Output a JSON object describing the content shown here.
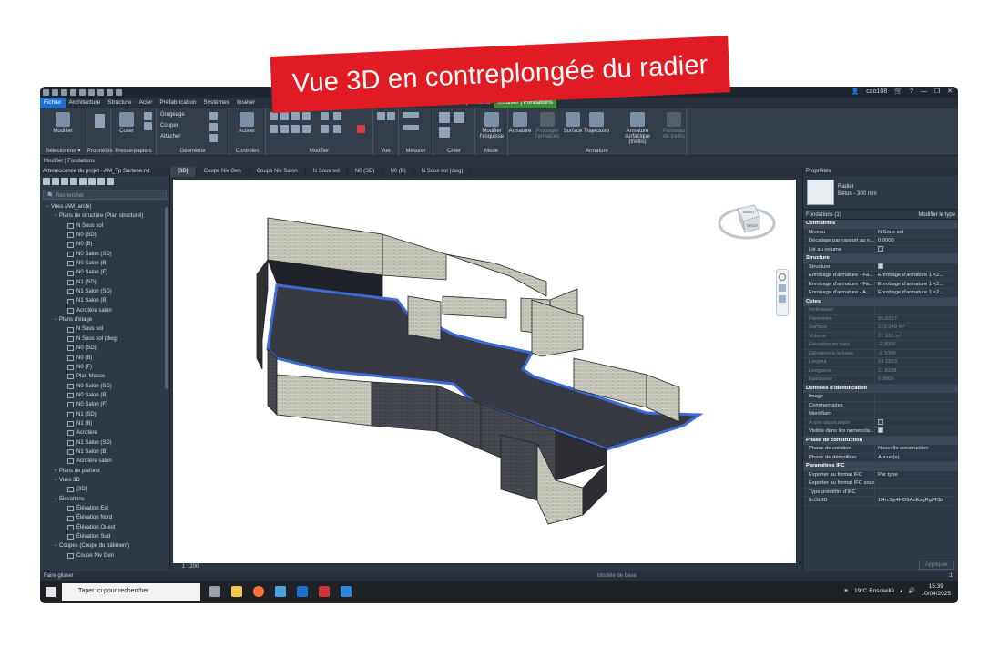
{
  "banner": {
    "text": "Vue 3D en contreplongée du radier",
    "color": "#e01b24"
  },
  "topbar": {
    "user": "cao108"
  },
  "tabs": [
    "Fichier",
    "Architecture",
    "Structure",
    "Acier",
    "Préfabrication",
    "Systèmes",
    "Insérer",
    "Compléments",
    "Modifier | Fondations"
  ],
  "ribbon": {
    "modify": "Modifier",
    "paste": "Coller",
    "cut": "Couper",
    "gruge": "Grugeage",
    "attach": "Attacher",
    "activate": "Activer",
    "edit_sketch": "Modifier l'esquisse",
    "armature": "Armature",
    "propagate": "Propager l'armature",
    "surface": "Surface",
    "trajectory": "Trajectoire",
    "area_rebar": "Armature surfacique (treillis)",
    "mesh_panel": "Panneau de treillis",
    "panels": [
      "Sélectionner ▾",
      "Propriétés",
      "Presse-papiers",
      "Géométrie",
      "Contrôles",
      "Modifier",
      "Vue",
      "Mesurer",
      "Créer",
      "Mode",
      "Armature"
    ]
  },
  "modbar": "Modifier | Fondations",
  "browser": {
    "title": "Arborescence du projet - AM_Tp Sartene.rvt",
    "search": "Rechercher",
    "tree": [
      {
        "t": "Vues (AM_archi)",
        "d": 0,
        "g": "−"
      },
      {
        "t": "Plans de structure (Plan structurel)",
        "d": 1,
        "g": "−"
      },
      {
        "t": "N Sous sol",
        "d": 2,
        "g": ""
      },
      {
        "t": "N0 (SD)",
        "d": 2,
        "g": ""
      },
      {
        "t": "N0 (B)",
        "d": 2,
        "g": ""
      },
      {
        "t": "N0 Salon (SD)",
        "d": 2,
        "g": ""
      },
      {
        "t": "N0 Salon (B)",
        "d": 2,
        "g": ""
      },
      {
        "t": "N0 Salon (F)",
        "d": 2,
        "g": ""
      },
      {
        "t": "N1 (SD)",
        "d": 2,
        "g": ""
      },
      {
        "t": "N1 Salon (SD)",
        "d": 2,
        "g": ""
      },
      {
        "t": "N1 Salon (B)",
        "d": 2,
        "g": ""
      },
      {
        "t": "Acrotère salon",
        "d": 2,
        "g": ""
      },
      {
        "t": "Plans d'étage",
        "d": 1,
        "g": "−"
      },
      {
        "t": "N Sous sol",
        "d": 2,
        "g": ""
      },
      {
        "t": "N Sous sol (dwg)",
        "d": 2,
        "g": ""
      },
      {
        "t": "N0 (SD)",
        "d": 2,
        "g": ""
      },
      {
        "t": "N0 (B)",
        "d": 2,
        "g": ""
      },
      {
        "t": "N0 (F)",
        "d": 2,
        "g": ""
      },
      {
        "t": "Plan Masse",
        "d": 2,
        "g": ""
      },
      {
        "t": "N0 Salon (SD)",
        "d": 2,
        "g": ""
      },
      {
        "t": "N0 Salon (B)",
        "d": 2,
        "g": ""
      },
      {
        "t": "N0 Salon (F)",
        "d": 2,
        "g": ""
      },
      {
        "t": "N1 (SD)",
        "d": 2,
        "g": ""
      },
      {
        "t": "N1 (B)",
        "d": 2,
        "g": ""
      },
      {
        "t": "Acrotère",
        "d": 2,
        "g": ""
      },
      {
        "t": "N1 Salon (SD)",
        "d": 2,
        "g": ""
      },
      {
        "t": "N1 Salon (B)",
        "d": 2,
        "g": ""
      },
      {
        "t": "Acrotère salon",
        "d": 2,
        "g": ""
      },
      {
        "t": "Plans de plafond",
        "d": 1,
        "g": "+"
      },
      {
        "t": "Vues 3D",
        "d": 1,
        "g": "−"
      },
      {
        "t": "{3D}",
        "d": 2,
        "g": ""
      },
      {
        "t": "Élévations",
        "d": 1,
        "g": "−"
      },
      {
        "t": "Élévation Est",
        "d": 2,
        "g": ""
      },
      {
        "t": "Élévation Nord",
        "d": 2,
        "g": ""
      },
      {
        "t": "Élévation Ouest",
        "d": 2,
        "g": ""
      },
      {
        "t": "Élévation Sud",
        "d": 2,
        "g": ""
      },
      {
        "t": "Coupes (Coupe du bâtiment)",
        "d": 1,
        "g": "−"
      },
      {
        "t": "Coupe Niv Gen",
        "d": 2,
        "g": ""
      }
    ]
  },
  "viewtabs": [
    "{3D}",
    "Coupe Niv Gen",
    "Coupe Niv Salon",
    "N Sous sol",
    "N0 (SD)",
    "N0 (B)",
    "N Sous sol (dwg)"
  ],
  "viewcube": {
    "face": "AVANT",
    "side": "DROIT"
  },
  "viewbar": {
    "scale": "1 : 200"
  },
  "properties": {
    "title": "Propriétés",
    "family": "Radier",
    "type": "Béton - 300 mm",
    "instance": "Fondations (1)",
    "edit_type": "Modifier le type",
    "sections": [
      {
        "name": "Contraintes",
        "rows": [
          {
            "k": "Niveau",
            "v": "N Sous sol",
            "dim": false
          },
          {
            "k": "Décalage par rapport au n...",
            "v": "0.0000",
            "dim": false
          },
          {
            "k": "Lié au volume",
            "v": "",
            "chk": "off",
            "dim": false
          }
        ]
      },
      {
        "name": "Structure",
        "rows": [
          {
            "k": "Structure",
            "v": "",
            "chk": "on",
            "dim": false
          },
          {
            "k": "Enrobage d'armature - Fa...",
            "v": "Enrobage d'armature 1 <2...",
            "dim": false
          },
          {
            "k": "Enrobage d'armature - Fa...",
            "v": "Enrobage d'armature 1 <2...",
            "dim": false
          },
          {
            "k": "Enrobage d'armature - A...",
            "v": "Enrobage d'armature 1 <2...",
            "dim": false
          }
        ]
      },
      {
        "name": "Cotes",
        "rows": [
          {
            "k": "Inclinaison",
            "v": "",
            "dim": true
          },
          {
            "k": "Périmètre",
            "v": "85.9317",
            "dim": true
          },
          {
            "k": "Surface",
            "v": "123.949 m²",
            "dim": true
          },
          {
            "k": "Volume",
            "v": "37.185 m³",
            "dim": true
          },
          {
            "k": "Élévation en haut",
            "v": "-2.8000",
            "dim": true
          },
          {
            "k": "Élévation à la base",
            "v": "-3.1000",
            "dim": true
          },
          {
            "k": "Largeur",
            "v": "24.1833",
            "dim": true
          },
          {
            "k": "Longueur",
            "v": "11.8228",
            "dim": true
          },
          {
            "k": "Épaisseur",
            "v": "0.3000",
            "dim": true
          }
        ]
      },
      {
        "name": "Données d'identification",
        "rows": [
          {
            "k": "Image",
            "v": "",
            "dim": false
          },
          {
            "k": "Commentaires",
            "v": "",
            "dim": false
          },
          {
            "k": "Identifiant",
            "v": "",
            "dim": false
          },
          {
            "k": "A une association",
            "v": "",
            "chk": "off",
            "dim": true
          },
          {
            "k": "Visible dans les nomencla...",
            "v": "",
            "chk": "on",
            "dim": false
          }
        ]
      },
      {
        "name": "Phase de construction",
        "rows": [
          {
            "k": "Phase de création",
            "v": "Nouvelle construction",
            "dim": false
          },
          {
            "k": "Phase de démolition",
            "v": "Aucun(e)",
            "dim": false
          }
        ]
      },
      {
        "name": "Paramètres IFC",
        "rows": [
          {
            "k": "Exporter au format IFC",
            "v": "Par type",
            "dim": false
          },
          {
            "k": "Exporter au format IFC sous",
            "v": "",
            "dim": false
          },
          {
            "k": "Type prédéfini d'IFC",
            "v": "",
            "dim": false
          },
          {
            "k": "IfcGUID",
            "v": "1l4rcSp4HD9AoEsgRgFF$z",
            "dim": false
          }
        ]
      }
    ],
    "apply": "Appliquer"
  },
  "status": {
    "left": "Faire glisser",
    "model": "Modèle de base",
    "sel": ":1"
  },
  "taskbar": {
    "search": "Taper ici pour rechercher",
    "weather": "19°C Ensoleillé",
    "time": "15:39",
    "date": "10/04/2025"
  }
}
